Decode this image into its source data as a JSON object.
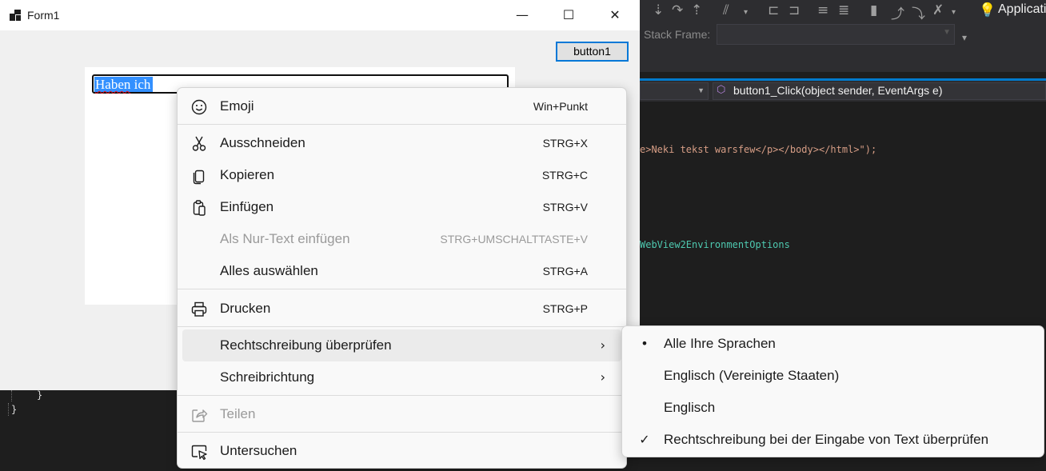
{
  "window": {
    "title": "Form1",
    "min_glyph": "—",
    "max_glyph": "☐",
    "close_glyph": "✕"
  },
  "form": {
    "button_label": "button1",
    "textbox_text_misspelled": "Haben",
    "textbox_text_rest": " ich"
  },
  "context_menu": {
    "items": [
      {
        "label": "Emoji",
        "shortcut": "Win+Punkt",
        "icon": "smiley-icon"
      },
      {
        "label": "Ausschneiden",
        "shortcut": "STRG+X",
        "icon": "scissors-icon"
      },
      {
        "label": "Kopieren",
        "shortcut": "STRG+C",
        "icon": "copy-icon"
      },
      {
        "label": "Einfügen",
        "shortcut": "STRG+V",
        "icon": "paste-icon"
      },
      {
        "label": "Als Nur-Text einfügen",
        "shortcut": "STRG+UMSCHALTTASTE+V",
        "disabled": true
      },
      {
        "label": "Alles auswählen",
        "shortcut": "STRG+A"
      },
      {
        "label": "Drucken",
        "shortcut": "STRG+P",
        "icon": "printer-icon"
      },
      {
        "label": "Rechtschreibung überprüfen",
        "submenu": true,
        "highlighted": true
      },
      {
        "label": "Schreibrichtung",
        "submenu": true
      },
      {
        "label": "Teilen",
        "disabled": true,
        "icon": "share-icon"
      },
      {
        "label": "Untersuchen",
        "icon": "inspect-icon"
      }
    ],
    "chevron": "›"
  },
  "spellcheck_submenu": {
    "items": [
      {
        "label": "Alle Ihre Sprachen",
        "mark": "•"
      },
      {
        "label": "Englisch (Vereinigte Staaten)",
        "mark": ""
      },
      {
        "label": "Englisch",
        "mark": ""
      },
      {
        "label": "Rechtschreibung bei der Eingabe von Text überprüfen",
        "mark": "✓"
      }
    ]
  },
  "ide": {
    "app_label": "Applicati",
    "stack_frame_label": "Stack Frame:",
    "method_signature": "button1_Click(object sender, EventArgs e)",
    "code_line_1": "e>Neki tekst warsfew</p></body></html>\");",
    "code_line_2": "WebView2EnvironmentOptions",
    "brace_inner": "}",
    "brace_outer": "}"
  },
  "colors": {
    "accent": "#0078d7",
    "selection": "#3390ff",
    "ide_blue": "#007acc"
  }
}
